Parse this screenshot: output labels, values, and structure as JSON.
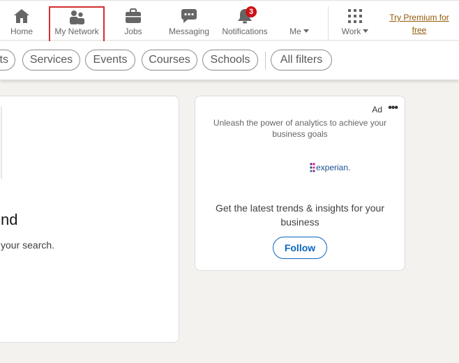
{
  "nav": {
    "items": [
      {
        "id": "home",
        "label": "Home",
        "icon": "home-icon"
      },
      {
        "id": "network",
        "label": "My Network",
        "icon": "people-icon",
        "selected": true
      },
      {
        "id": "jobs",
        "label": "Jobs",
        "icon": "briefcase-icon"
      },
      {
        "id": "messaging",
        "label": "Messaging",
        "icon": "chat-icon"
      },
      {
        "id": "notifications",
        "label": "Notifications",
        "icon": "bell-icon",
        "badge": "3"
      },
      {
        "id": "me",
        "label": "Me",
        "icon": "chevron-down-icon"
      },
      {
        "id": "work",
        "label": "Work",
        "icon": "grid-icon"
      }
    ],
    "premium": {
      "line1": "Try Premium for",
      "line2": "free"
    },
    "notification_count": "3"
  },
  "filters": {
    "partial": "ts",
    "pills": [
      "Services",
      "Events",
      "Courses",
      "Schools"
    ],
    "all": "All filters"
  },
  "main": {
    "title_fragment": "nd",
    "subtitle_fragment": "your search."
  },
  "ad": {
    "label": "Ad",
    "more": "•••",
    "tagline": "Unleash the power of analytics to achieve your business goals",
    "logo_text": "experian.",
    "body": "Get the latest trends & insights for your business",
    "follow": "Follow"
  },
  "colors": {
    "selected_outline": "#d32f2f",
    "badge": "#cc1016",
    "brand_blue": "#0a66c2",
    "premium": "#915907"
  }
}
